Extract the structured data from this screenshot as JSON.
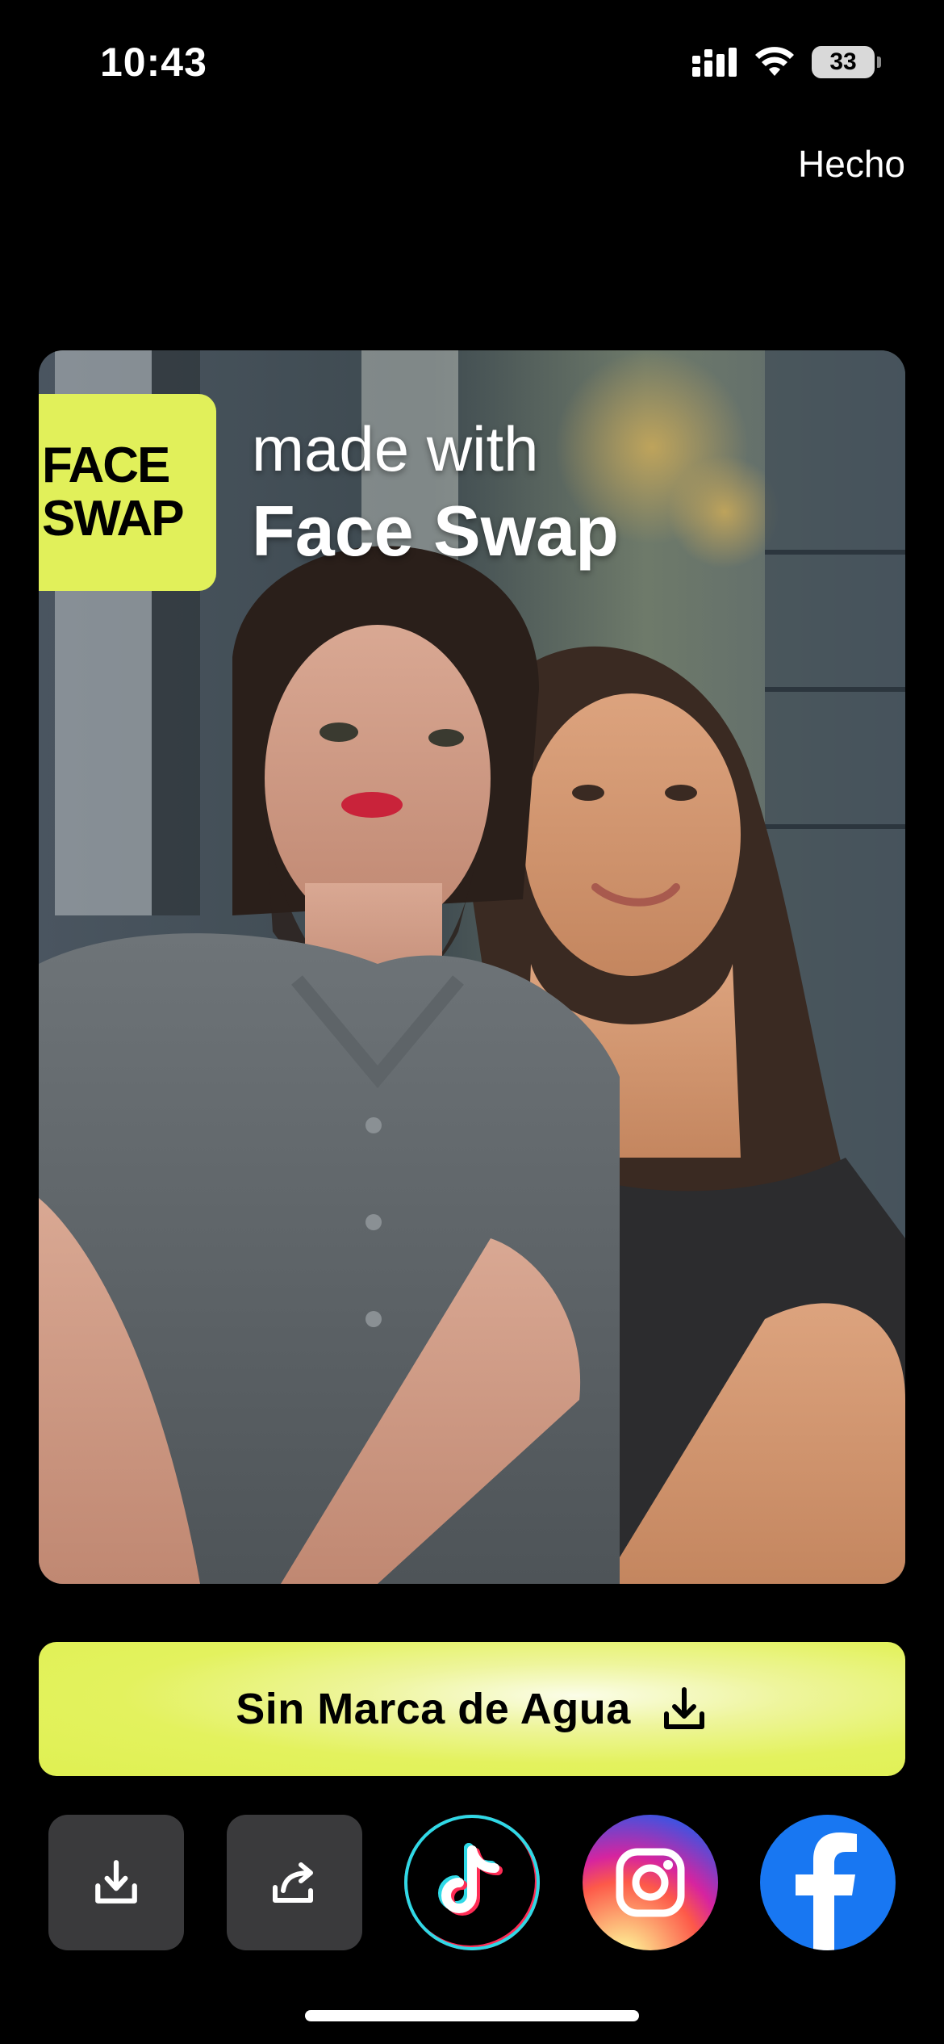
{
  "status_bar": {
    "time": "10:43",
    "battery": "33",
    "icons": [
      "signal-icon",
      "wifi-icon",
      "battery-icon"
    ]
  },
  "header": {
    "done_label": "Hecho"
  },
  "preview": {
    "watermark_badge_line1": "FACE",
    "watermark_badge_line2": "SWAP",
    "watermark_line1": "made with",
    "watermark_line2": "Face Swap",
    "accent_color": "#e1f05a"
  },
  "actions": {
    "no_watermark_label": "Sin Marca de Agua",
    "no_watermark_icon": "download-icon",
    "share_buttons": [
      {
        "icon": "save-icon"
      },
      {
        "icon": "share-icon"
      },
      {
        "icon": "tiktok-icon"
      },
      {
        "icon": "instagram-icon"
      },
      {
        "icon": "facebook-icon"
      }
    ]
  },
  "colors": {
    "background": "#000000",
    "button_gray": "#3a3a3c",
    "facebook_blue": "#1877f2"
  }
}
